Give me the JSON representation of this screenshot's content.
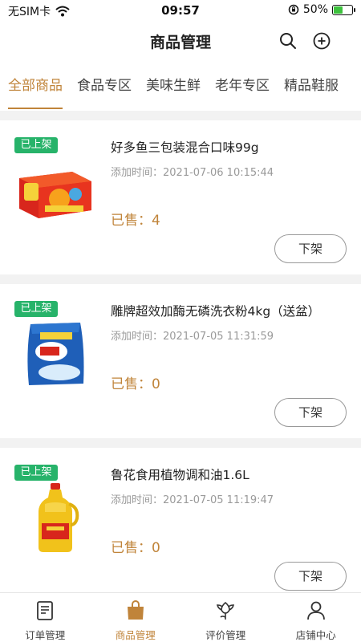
{
  "status_bar": {
    "carrier": "无SIM卡",
    "time": "09:57",
    "battery": "50%",
    "battery_level": 0.5
  },
  "header": {
    "title": "商品管理",
    "icons": [
      "search-icon",
      "add-circle-icon"
    ]
  },
  "tabs": [
    {
      "label": "全部商品",
      "active": true
    },
    {
      "label": "食品专区",
      "active": false
    },
    {
      "label": "美味生鲜",
      "active": false
    },
    {
      "label": "老年专区",
      "active": false
    },
    {
      "label": "精品鞋服",
      "active": false
    }
  ],
  "products": [
    {
      "status": "已上架",
      "name": "好多鱼三包装混合口味99g",
      "time": "添加时间：2021-07-06 10:15:44",
      "sold": "已售：4",
      "action": "下架"
    },
    {
      "status": "已上架",
      "name": "雕牌超效加酶无磷洗衣粉4kg（送盆）",
      "time": "添加时间：2021-07-05 11:31:59",
      "sold": "已售：0",
      "action": "下架"
    },
    {
      "status": "已上架",
      "name": "鲁花食用植物调和油1.6L",
      "time": "添加时间：2021-07-05 11:19:47",
      "sold": "已售：0",
      "action": "下架"
    }
  ],
  "bottom_nav": [
    {
      "label": "订单管理",
      "icon": "order-list-icon",
      "active": false
    },
    {
      "label": "商品管理",
      "icon": "shopping-bag-icon",
      "active": true
    },
    {
      "label": "评价管理",
      "icon": "flower-icon",
      "active": false
    },
    {
      "label": "店铺中心",
      "icon": "user-icon",
      "active": false
    }
  ],
  "colors": {
    "accent": "#c0843a",
    "badge": "#27b36a"
  }
}
